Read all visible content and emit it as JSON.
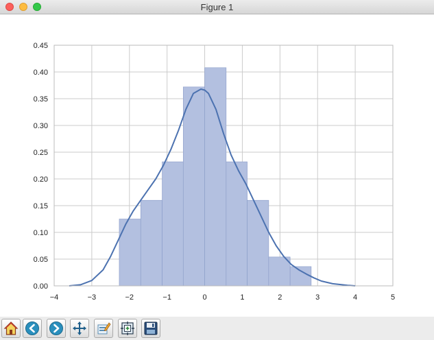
{
  "window": {
    "title": "Figure 1"
  },
  "toolbar": {
    "buttons": [
      {
        "name": "home-button",
        "icon": "home-icon"
      },
      {
        "name": "back-button",
        "icon": "arrow-left-icon"
      },
      {
        "name": "forward-button",
        "icon": "arrow-right-icon"
      },
      {
        "name": "pan-button",
        "icon": "move-arrows-icon"
      },
      {
        "name": "configure-subplots-button",
        "icon": "edit-subplots-icon"
      },
      {
        "name": "zoom-button",
        "icon": "zoom-rect-icon"
      },
      {
        "name": "save-button",
        "icon": "floppy-disk-icon"
      }
    ]
  },
  "colors": {
    "hist_fill": "#b3c0e0",
    "hist_edge": "#8a9cc8",
    "kde": "#4c72b0",
    "grid": "#cbcbcb"
  },
  "chart_data": {
    "type": "histogram",
    "xlim": [
      -4,
      5
    ],
    "ylim": [
      0,
      0.45
    ],
    "x_ticks": [
      -4,
      -3,
      -2,
      -1,
      0,
      1,
      2,
      3,
      4,
      5
    ],
    "x_tick_labels": [
      "−4",
      "−3",
      "−2",
      "−1",
      "0",
      "1",
      "2",
      "3",
      "4",
      "5"
    ],
    "y_ticks": [
      0.0,
      0.05,
      0.1,
      0.15,
      0.2,
      0.25,
      0.3,
      0.35,
      0.4,
      0.45
    ],
    "y_tick_labels": [
      "0.00",
      "0.05",
      "0.10",
      "0.15",
      "0.20",
      "0.25",
      "0.30",
      "0.35",
      "0.40",
      "0.45"
    ],
    "grid": true,
    "bins": [
      {
        "x0": -2.27,
        "x1": -1.7,
        "density": 0.125
      },
      {
        "x0": -1.7,
        "x1": -1.13,
        "density": 0.16
      },
      {
        "x0": -1.13,
        "x1": -0.57,
        "density": 0.232
      },
      {
        "x0": -0.57,
        "x1": 0.0,
        "density": 0.372
      },
      {
        "x0": 0.0,
        "x1": 0.57,
        "density": 0.408
      },
      {
        "x0": 0.57,
        "x1": 1.13,
        "density": 0.232
      },
      {
        "x0": 1.13,
        "x1": 1.7,
        "density": 0.16
      },
      {
        "x0": 1.7,
        "x1": 2.27,
        "density": 0.054
      },
      {
        "x0": 2.27,
        "x1": 2.83,
        "density": 0.036
      }
    ],
    "kde": {
      "x": [
        -3.6,
        -3.3,
        -3.0,
        -2.7,
        -2.5,
        -2.3,
        -2.1,
        -1.9,
        -1.7,
        -1.5,
        -1.3,
        -1.1,
        -0.9,
        -0.7,
        -0.5,
        -0.3,
        -0.1,
        0.0,
        0.1,
        0.3,
        0.5,
        0.7,
        0.9,
        1.1,
        1.3,
        1.5,
        1.7,
        1.9,
        2.1,
        2.3,
        2.5,
        2.7,
        2.9,
        3.1,
        3.4,
        3.8,
        4.0
      ],
      "y": [
        0.0,
        0.002,
        0.01,
        0.03,
        0.055,
        0.085,
        0.115,
        0.14,
        0.16,
        0.18,
        0.2,
        0.225,
        0.255,
        0.29,
        0.33,
        0.36,
        0.368,
        0.366,
        0.36,
        0.33,
        0.285,
        0.245,
        0.215,
        0.19,
        0.16,
        0.13,
        0.1,
        0.075,
        0.055,
        0.04,
        0.03,
        0.022,
        0.015,
        0.009,
        0.004,
        0.001,
        0.0
      ]
    }
  }
}
